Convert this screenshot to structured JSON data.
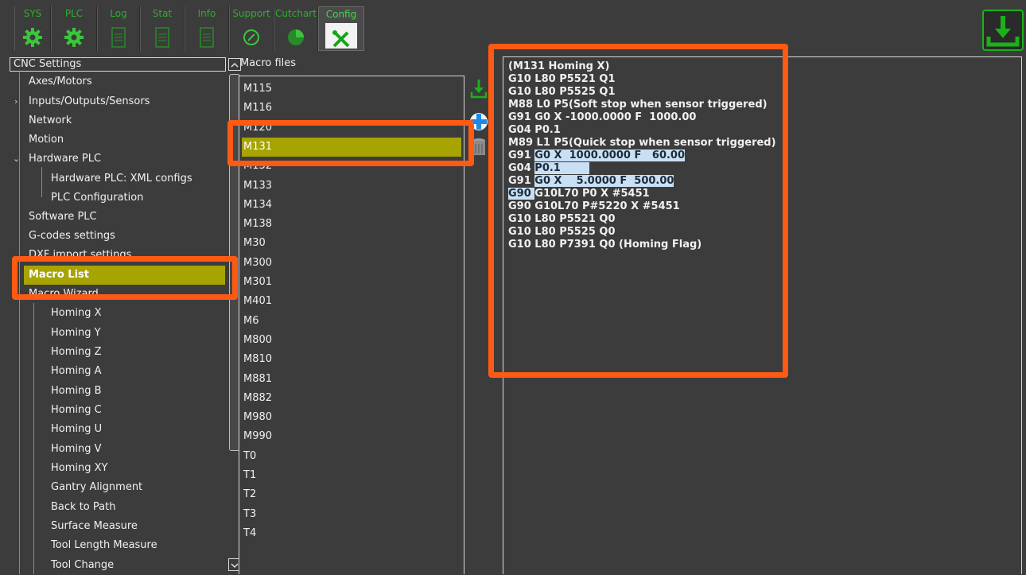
{
  "toolbar": {
    "tabs": [
      {
        "label": "SYS",
        "icon": "gear-icon"
      },
      {
        "label": "PLC",
        "icon": "gear-icon"
      },
      {
        "label": "Log",
        "icon": "document-icon"
      },
      {
        "label": "Stat",
        "icon": "document-icon"
      },
      {
        "label": "Info",
        "icon": "document-icon"
      },
      {
        "label": "Support",
        "icon": "gauge-icon"
      },
      {
        "label": "Cutchart",
        "icon": "pie-icon"
      },
      {
        "label": "Config",
        "icon": "tools-icon"
      }
    ],
    "active_tab": "Config",
    "save_icon": "download-save-icon"
  },
  "tree": {
    "header": "CNC Settings",
    "items": [
      {
        "label": "Axes/Motors"
      },
      {
        "label": "Inputs/Outputs/Sensors"
      },
      {
        "label": "Network"
      },
      {
        "label": "Motion"
      },
      {
        "label": "Hardware PLC"
      },
      {
        "label": "Hardware PLC: XML configs"
      },
      {
        "label": "PLC Configuration"
      },
      {
        "label": "Software PLC"
      },
      {
        "label": "G-codes settings"
      },
      {
        "label": "DXF import settings"
      },
      {
        "label": "Macro List"
      },
      {
        "label": "Macro Wizard"
      },
      {
        "label": "Homing X"
      },
      {
        "label": "Homing Y"
      },
      {
        "label": "Homing Z"
      },
      {
        "label": "Homing A"
      },
      {
        "label": "Homing B"
      },
      {
        "label": "Homing C"
      },
      {
        "label": "Homing U"
      },
      {
        "label": "Homing V"
      },
      {
        "label": "Homing XY"
      },
      {
        "label": "Gantry Alignment"
      },
      {
        "label": "Back to Path"
      },
      {
        "label": "Surface Measure"
      },
      {
        "label": "Tool Length Measure"
      },
      {
        "label": "Tool Change"
      }
    ],
    "selected": "Macro List"
  },
  "macros": {
    "label": "Macro files",
    "items": [
      "M115",
      "M116",
      "M120",
      "M131",
      "M132",
      "M133",
      "M134",
      "M138",
      "M30",
      "M300",
      "M301",
      "M401",
      "M6",
      "M800",
      "M810",
      "M881",
      "M882",
      "M980",
      "M990",
      "T0",
      "T1",
      "T2",
      "T3",
      "T4"
    ],
    "selected": "M131"
  },
  "side_buttons": [
    "download-icon",
    "add-icon",
    "delete-icon"
  ],
  "code": {
    "lines": [
      "(M131 Homing X)",
      "G10 L80 P5521 Q1",
      "G10 L80 P5525 Q1",
      "M88 L0 P5(Soft stop when sensor triggered)",
      "G91 G0 X -1000.0000 F  1000.00",
      "G04 P0.1",
      "M89 L1 P5(Quick stop when sensor triggered)",
      "G91 G0 X  1000.0000 F   60.00",
      "G04 P0.1",
      "G91 G0 X    5.0000 F  500.00",
      "G90 G10L70 P0 X #5451",
      "G90 G10L70 P#5220 X #5451",
      "G10 L80 P5521 Q0",
      "G10 L80 P5525 Q0",
      "G10 L80 P7391 Q0 (Homing Flag)"
    ]
  },
  "colors": {
    "background": "#3c3c3c",
    "selection": "#a7a300",
    "accent_green": "#2fae2f",
    "annotation": "#ff5a14",
    "code_highlight": "#c9e0f4"
  }
}
